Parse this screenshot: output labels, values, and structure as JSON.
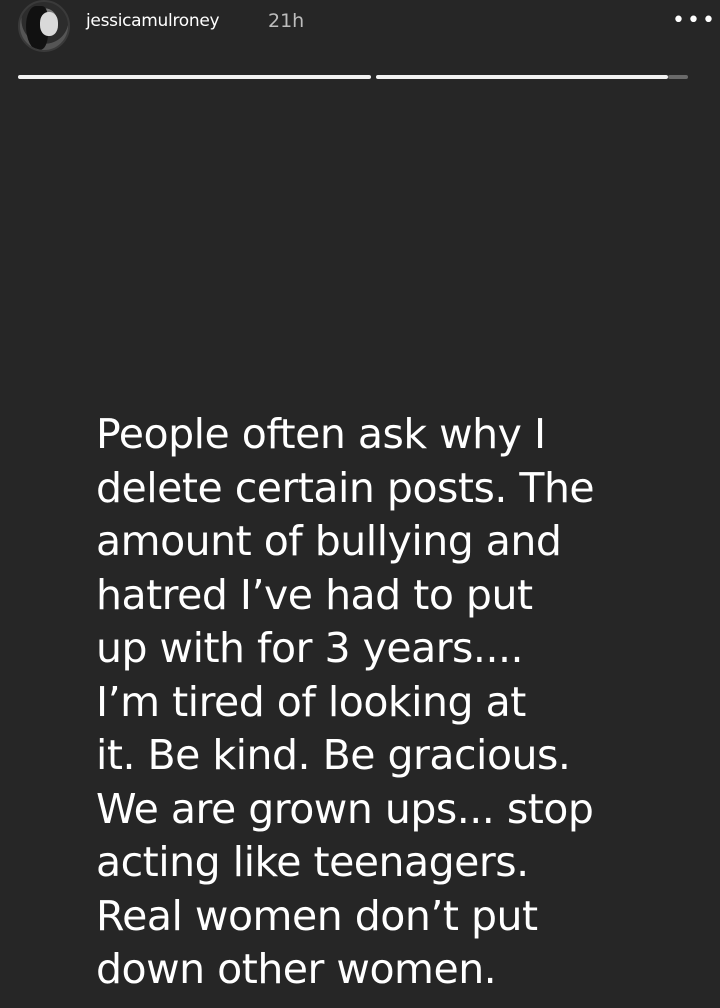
{
  "story": {
    "username": "jessicamulroney",
    "timestamp": "21h",
    "more_glyph": "•••",
    "avatar_icon": "profile-photo-icon",
    "progress": {
      "segments": 2,
      "current_segment": 2,
      "current_segment_fraction": 0.93
    },
    "message_lines": [
      "People often ask why I",
      "delete certain posts. The",
      "amount of bullying and",
      "hatred I’ve had to put",
      "up with for 3 years....",
      "I’m tired of looking at",
      "it. Be kind. Be gracious.",
      "We are grown ups... stop",
      "acting like teenagers.",
      "Real women don’t put",
      "down other women."
    ],
    "colors": {
      "background": "#262626",
      "text": "#ffffff",
      "timestamp": "#bdbdbd"
    }
  }
}
